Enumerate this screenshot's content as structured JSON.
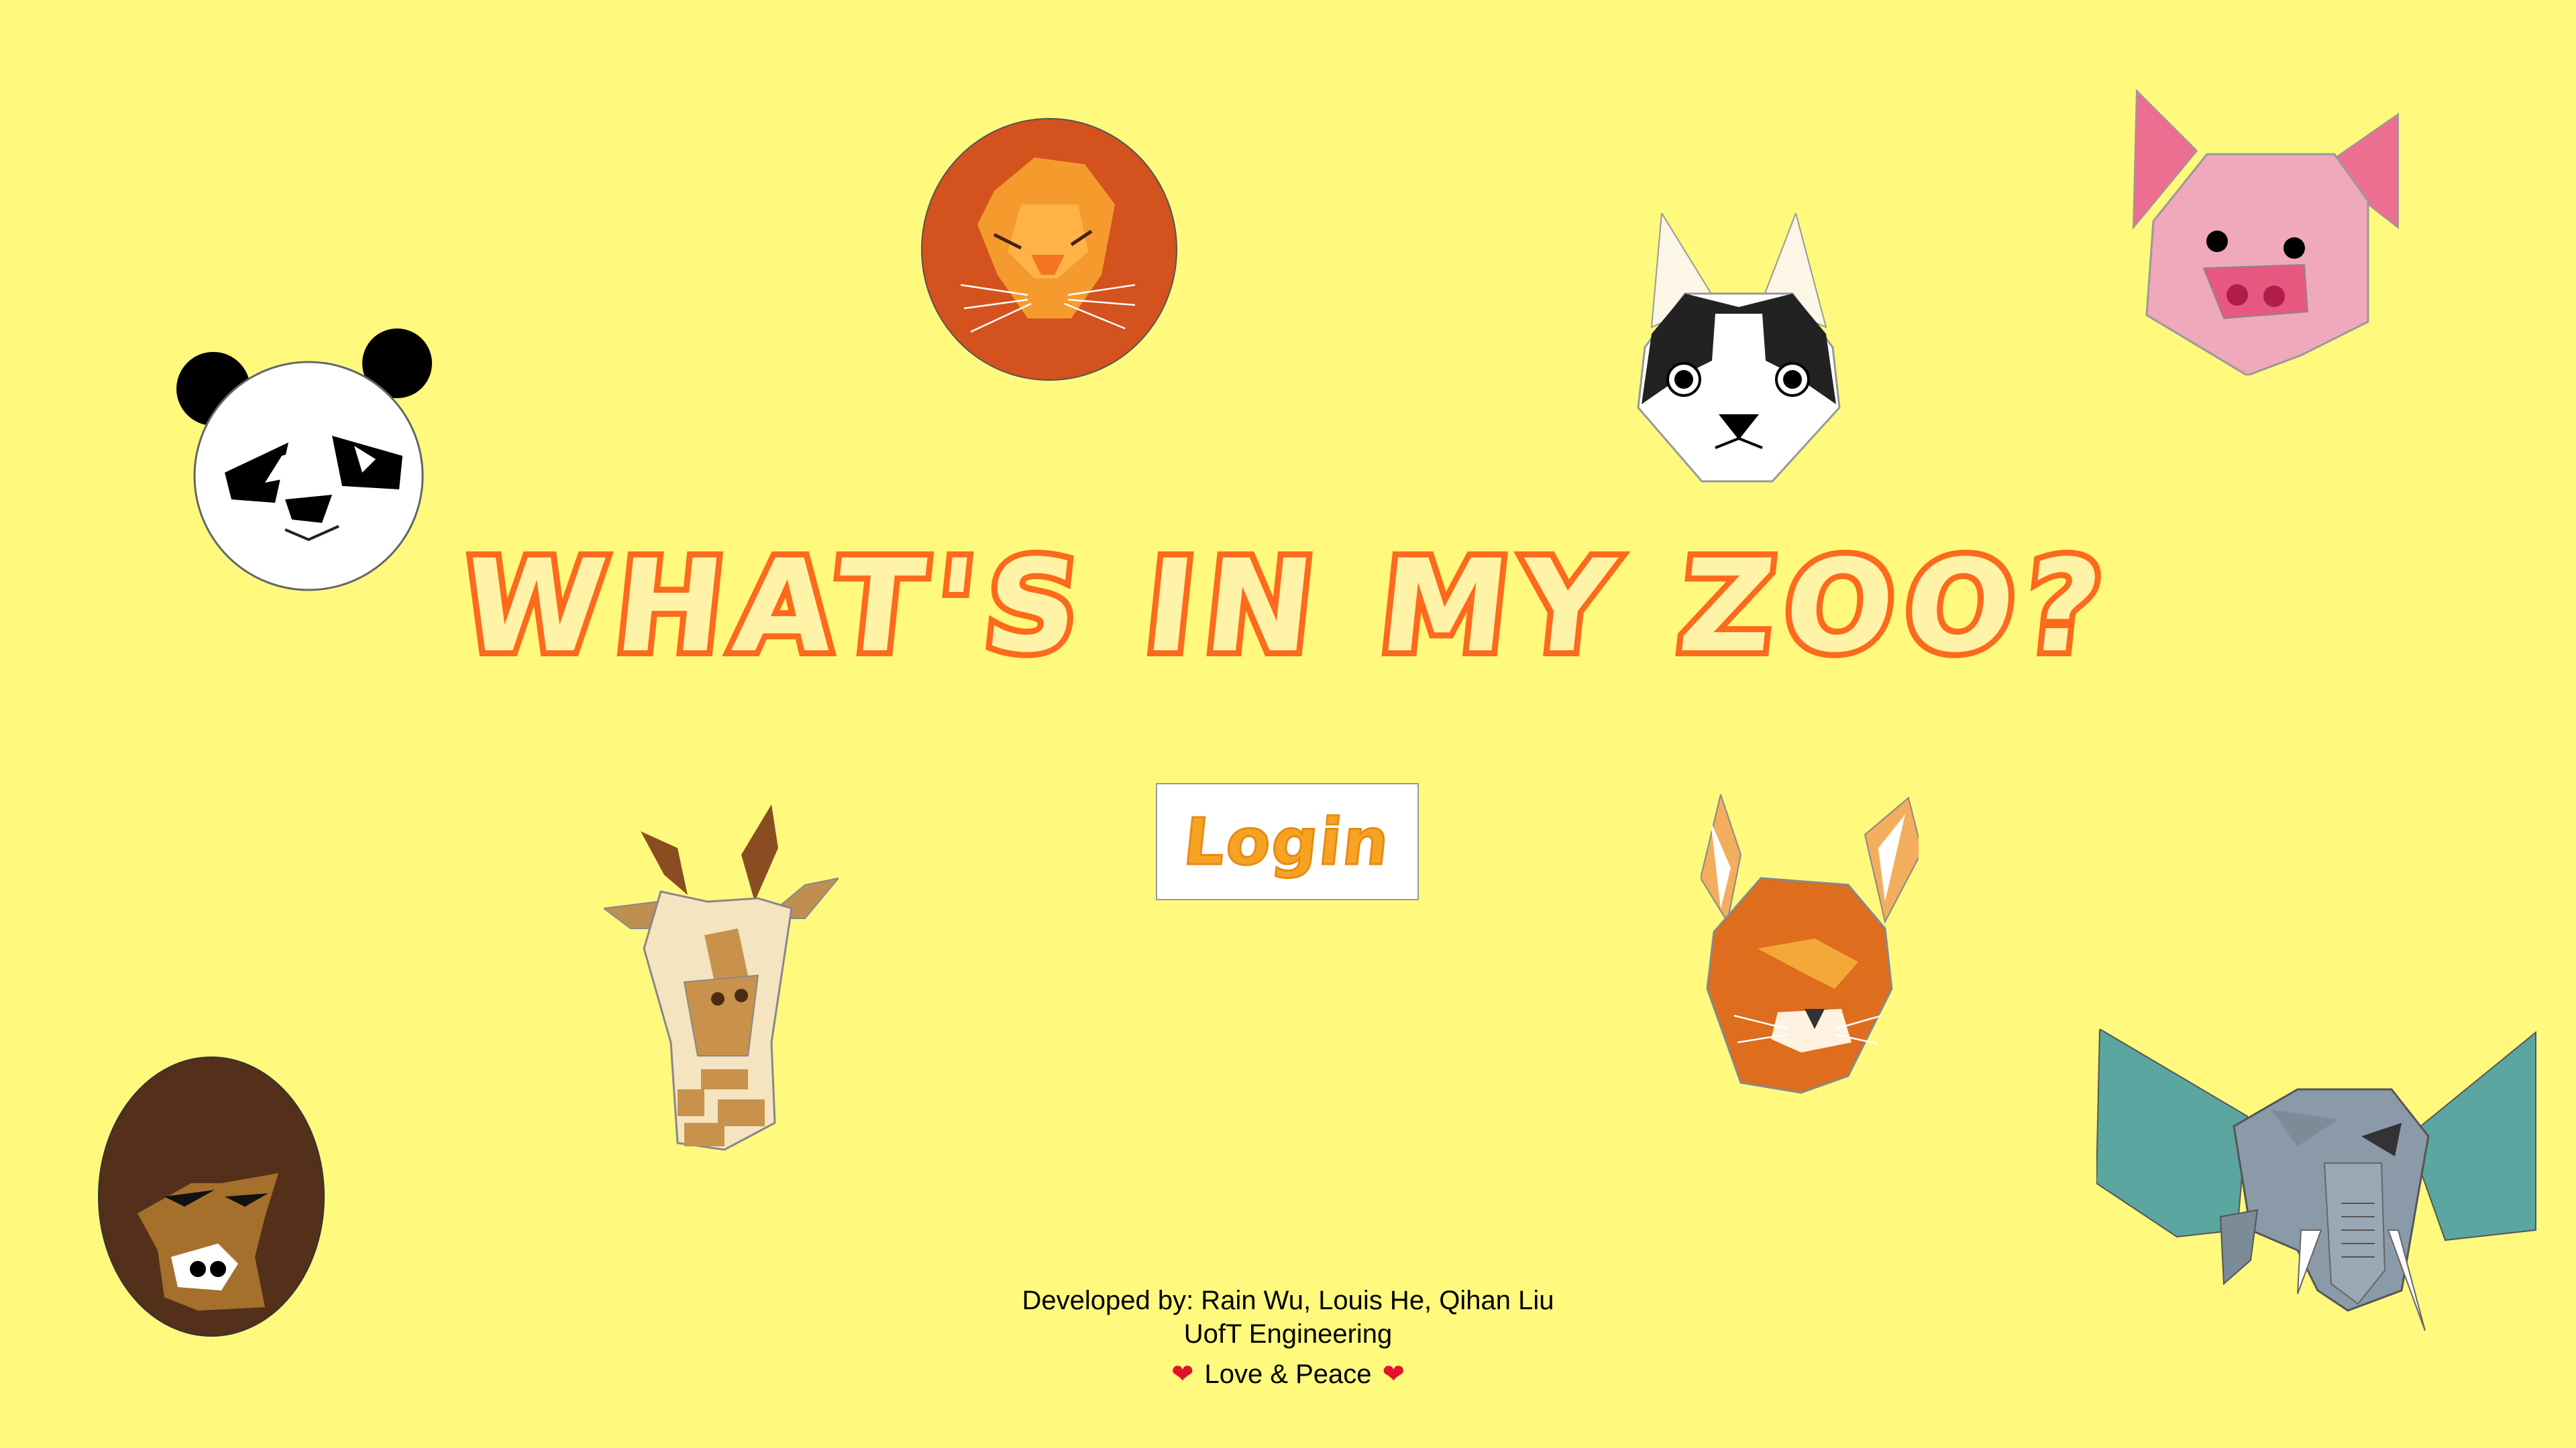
{
  "app": {
    "title": "WHAT'S IN MY ZOO?",
    "login_label": "Login"
  },
  "footer": {
    "developers": "Developed by: Rain Wu, Louis He, Qihan Liu",
    "school": "UofT Engineering",
    "tagline": "Love & Peace",
    "heart_icon": "heart-icon"
  },
  "colors": {
    "background": "#fff97e",
    "title_stroke": "#fd6a1c",
    "title_fill": "#fff3a8",
    "login_text": "#f6a324"
  },
  "animals": [
    "panda",
    "lion",
    "husky",
    "pig",
    "giraffe",
    "fox",
    "gorilla",
    "elephant"
  ]
}
